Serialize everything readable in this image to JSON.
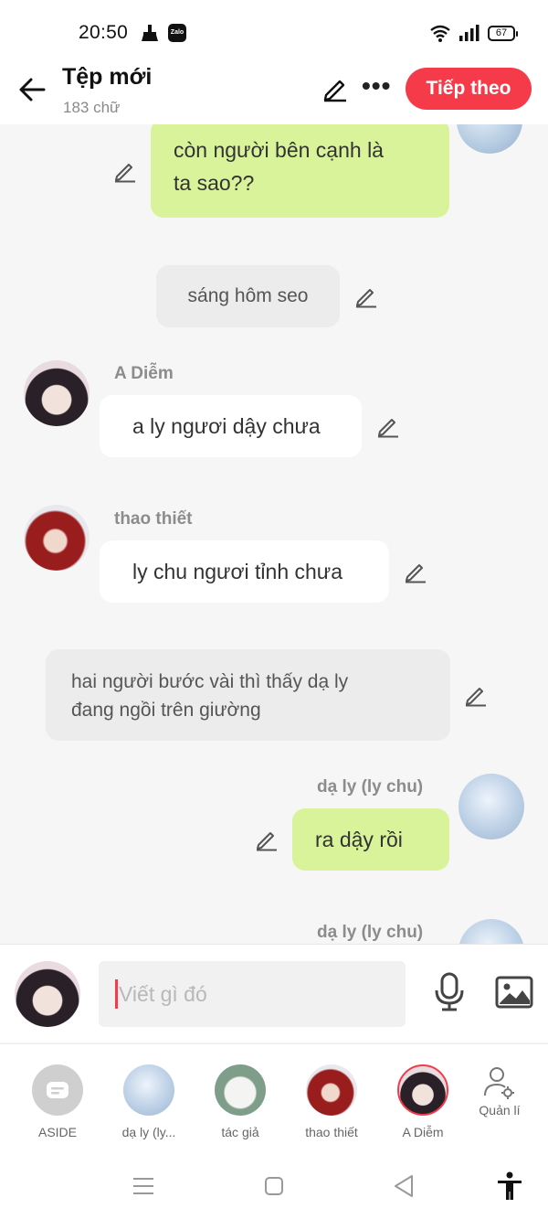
{
  "status": {
    "time": "20:50",
    "battery": "67",
    "zalo": "Zalo"
  },
  "header": {
    "title": "Tệp mới",
    "subtitle": "183 chữ",
    "next_label": "Tiếp theo"
  },
  "messages": [
    {
      "type": "right",
      "text_line1": "còn người bên cạnh là",
      "text_line2": "ta sao??"
    },
    {
      "type": "narration",
      "text": "sáng hôm seo"
    },
    {
      "type": "left",
      "name": "A Diễm",
      "text": "a ly ngươi dậy chưa"
    },
    {
      "type": "left",
      "name": "thao thiết",
      "text": "ly chu ngươi tỉnh chưa"
    },
    {
      "type": "narration",
      "text_line1": "hai người bước vài thì thấy dạ ly",
      "text_line2": "đang ngồi trên giường"
    },
    {
      "type": "right",
      "name": "dạ ly (ly chu)",
      "text": "ra dậy rồi"
    },
    {
      "type": "right",
      "name": "dạ ly (ly chu)"
    }
  ],
  "input": {
    "placeholder": "Viết gì đó"
  },
  "characters": [
    {
      "label": "ASIDE"
    },
    {
      "label": "dạ ly (ly..."
    },
    {
      "label": "tác giả"
    },
    {
      "label": "thao thiết"
    },
    {
      "label": "A Diễm"
    },
    {
      "label": "Quản lí"
    }
  ],
  "colors": {
    "accent": "#f53b4a",
    "green_bubble": "#d8f39a",
    "white_bubble": "#ffffff",
    "gray_bubble": "#ececec"
  }
}
